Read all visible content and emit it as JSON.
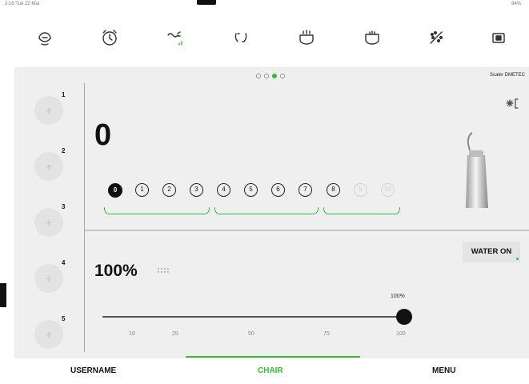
{
  "status_bar": {
    "left": "2:16 Tue 22 Mar",
    "right": "94%"
  },
  "toolbar": {
    "icons": [
      "dentist-face-icon",
      "alarm-clock-icon",
      "spray-settings-icon",
      "bracket-arc-icon",
      "hot-water-icon",
      "water-bowl-icon",
      "sprinkle-cleaning-icon",
      "window-program-icon"
    ]
  },
  "carousel": {
    "pages": 4,
    "active_index": 2
  },
  "instrument": {
    "name": "Scaler DMETEC"
  },
  "power": {
    "value": "0"
  },
  "power_levels": {
    "labels": [
      "0",
      "1",
      "2",
      "3",
      "4",
      "5",
      "6",
      "7",
      "8",
      "9",
      "10"
    ],
    "selected": "0",
    "disabled": [
      "9",
      "10"
    ]
  },
  "memory_slots": [
    {
      "label": "1",
      "icon": "+"
    },
    {
      "label": "2",
      "icon": "+"
    },
    {
      "label": "3",
      "icon": "+"
    },
    {
      "label": "4",
      "icon": "+"
    },
    {
      "label": "5",
      "icon": "+"
    }
  ],
  "water": {
    "percent_display": "100%",
    "button_label": "WATER ON",
    "slider": {
      "value": 100,
      "min": 10,
      "max": 100,
      "value_label": "100%",
      "ticks": [
        "10",
        "25",
        "50",
        "75",
        "100"
      ]
    }
  },
  "bottom_nav": {
    "items": [
      "USERNAME",
      "CHAIR",
      "MENU"
    ],
    "active": "CHAIR"
  },
  "colors": {
    "accent": "#2fc030",
    "panel": "#efefef",
    "selected": "#111111"
  }
}
